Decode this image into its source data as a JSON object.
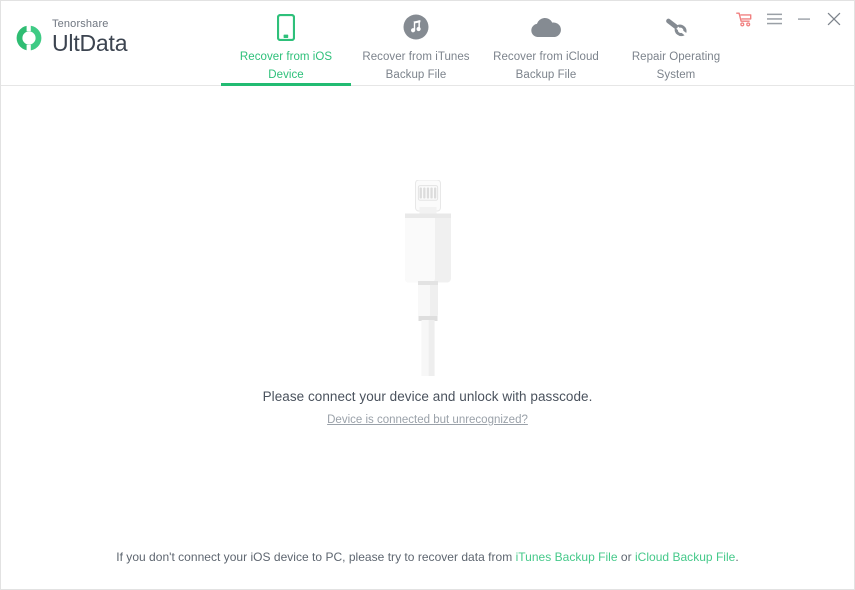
{
  "window": {
    "brand_top": "Tenorshare",
    "brand_name": "UltData",
    "controls": [
      {
        "name": "cart-icon",
        "label": "Buy"
      },
      {
        "name": "menu-icon",
        "label": "Menu"
      },
      {
        "name": "minimize-icon",
        "label": "Minimize"
      },
      {
        "name": "close-icon",
        "label": "Close"
      }
    ]
  },
  "tabs": [
    {
      "label": "Recover from iOS\nDevice",
      "icon": "phone-icon",
      "active": true
    },
    {
      "label": "Recover from iTunes\nBackup File",
      "icon": "music-note-icon",
      "active": false
    },
    {
      "label": "Recover from iCloud\nBackup File",
      "icon": "cloud-icon",
      "active": false
    },
    {
      "label": "Repair Operating\nSystem",
      "icon": "wrench-icon",
      "active": false
    }
  ],
  "main": {
    "illustration": "lightning-cable-illustration",
    "prompt_text": "Please connect your device and unlock with passcode.",
    "prompt_link": "Device is connected but unrecognized?",
    "footnote": {
      "prefix": "If you don't connect your iOS device to PC, please try to recover data from ",
      "link1": "iTunes Backup File",
      "middle": " or ",
      "link2": "iCloud Backup File",
      "suffix": "."
    }
  },
  "colors": {
    "accent_green": "#2ec07a",
    "tab_underline": "#22bb72",
    "link_green": "#45c98a",
    "inactive_gray": "#7c838c",
    "cart_red": "#f08080"
  }
}
